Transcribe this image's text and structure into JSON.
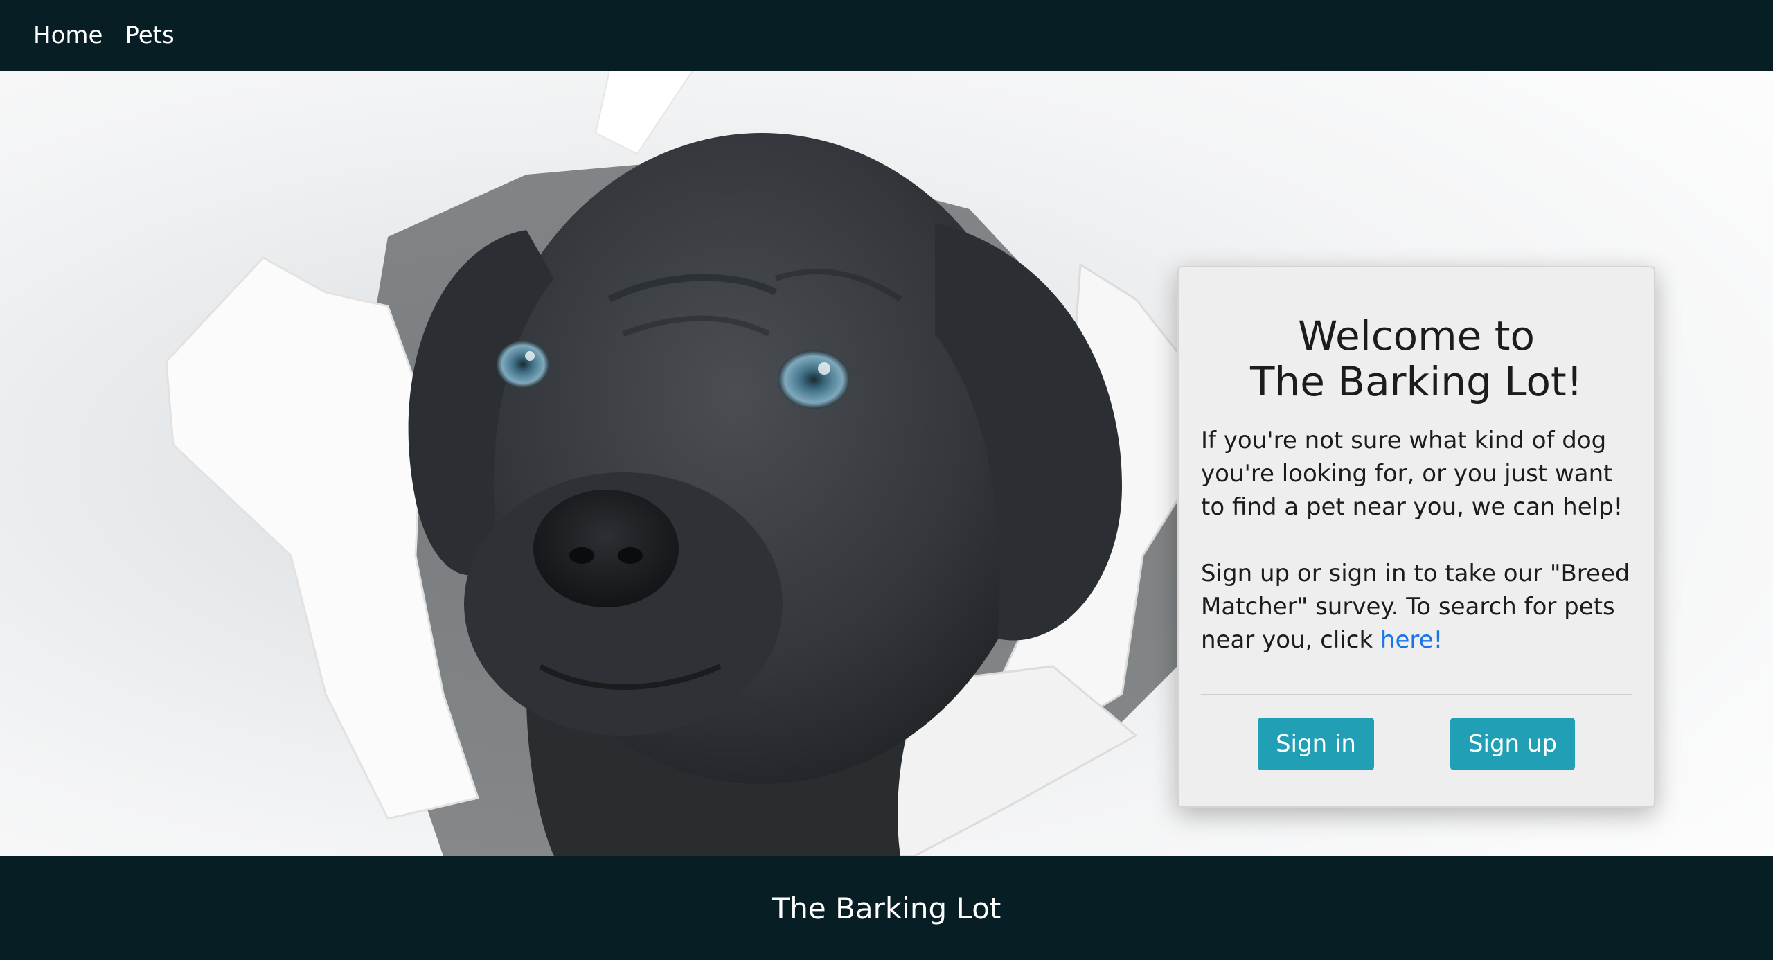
{
  "nav": {
    "items": [
      {
        "label": "Home"
      },
      {
        "label": "Pets"
      }
    ]
  },
  "hero": {
    "image_subject": "black puppy bursting through white paper"
  },
  "card": {
    "title_line1": "Welcome to",
    "title_line2": "The Barking Lot!",
    "paragraph1": "If you're not sure what kind of dog you're looking for, or you just want to find a pet near you, we can help!",
    "paragraph2_prefix": "Sign up or sign in to take our \"Breed Matcher\" survey. To search for pets near you, click ",
    "link_text": "here!",
    "signin_label": "Sign in",
    "signup_label": "Sign up"
  },
  "footer": {
    "text": "The Barking Lot"
  },
  "colors": {
    "navbar_bg": "#061e24",
    "card_bg": "#eeeeee",
    "button_bg": "#21a0b5",
    "link": "#1a73e8"
  }
}
